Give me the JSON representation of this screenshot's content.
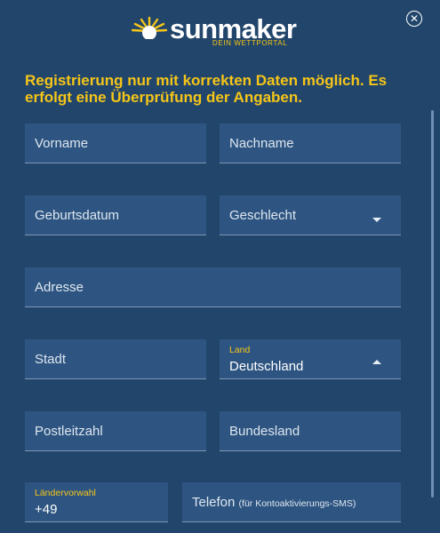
{
  "header": {
    "brand": "sunmaker",
    "tagline": "DEIN WETTPORTAL",
    "logo_icon": "sun-icon",
    "close_icon": "close-icon"
  },
  "notice": "Registrierung nur mit korrekten Daten möglich. Es erfolgt eine Überprüfung der Angaben.",
  "form": {
    "first_name": "Vorname",
    "last_name": "Nachname",
    "birthdate": "Geburtsdatum",
    "gender": "Geschlecht",
    "address": "Adresse",
    "city": "Stadt",
    "country_label": "Land",
    "country_value": "Deutschland",
    "postal_code": "Postleitzahl",
    "state": "Bundesland",
    "dial_code_label": "Ländervorwahl",
    "dial_code_value": "+49",
    "phone": "Telefon",
    "phone_hint": "(für Kontoaktivierungs-SMS)"
  },
  "colors": {
    "background": "#22466b",
    "field": "#2e5581",
    "accent": "#f5c518"
  }
}
